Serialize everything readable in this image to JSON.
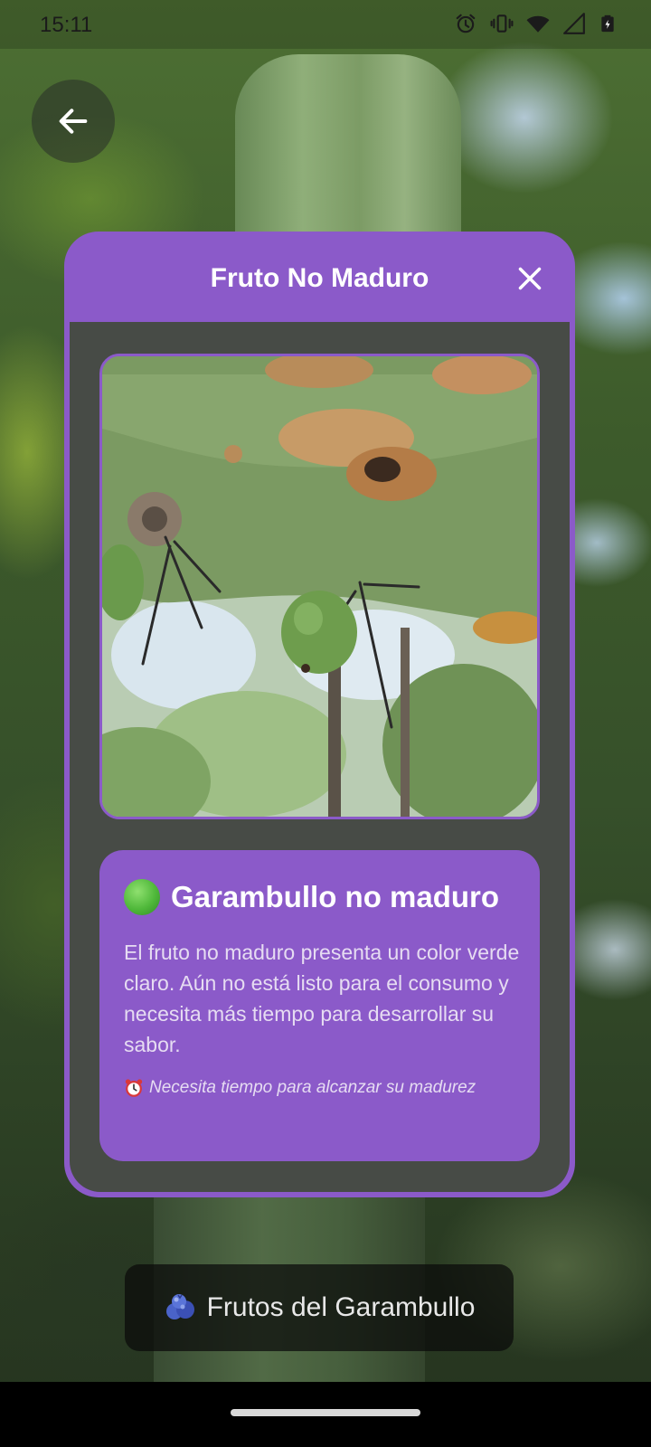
{
  "status_bar": {
    "time": "15:11",
    "icons": [
      "alarm-icon",
      "vibrate-icon",
      "wifi-icon",
      "signal-icon",
      "battery-icon"
    ]
  },
  "back_button": {
    "icon": "arrow-left-icon"
  },
  "dialog": {
    "title": "Fruto No Maduro",
    "close_icon": "close-icon",
    "accent_color": "#8b5ac9",
    "body_color": "#474b46",
    "card": {
      "status_icon": "green-circle-icon",
      "title": "Garambullo no maduro",
      "description": "El fruto no maduro presenta un color verde claro. Aún no está listo para el consumo y necesita más tiempo para desarrollar su sabor.",
      "note_icon": "alarm-clock-icon",
      "note": "Necesita tiempo para alcanzar su madurez"
    }
  },
  "bottom_label": {
    "icon": "blueberries-icon",
    "text": "Frutos del Garambullo"
  }
}
